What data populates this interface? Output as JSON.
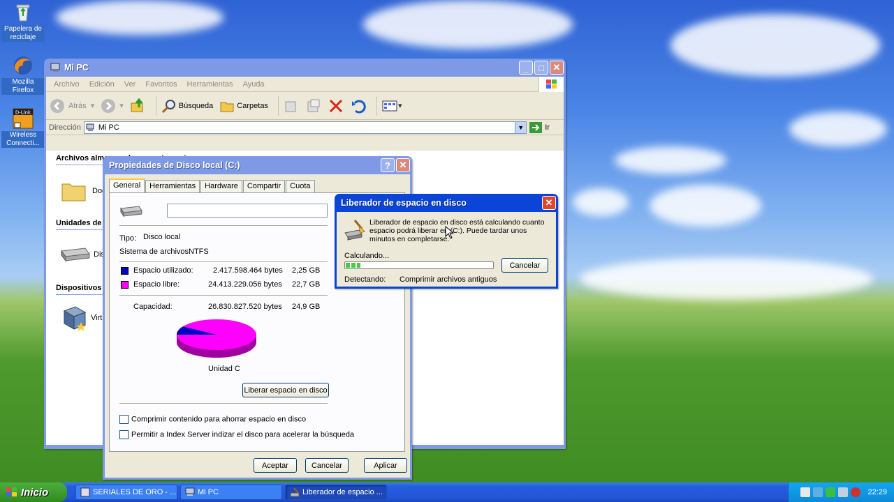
{
  "desktop": {
    "icons": [
      {
        "label": "Papelera de reciclaje"
      },
      {
        "label": "Mozilla Firefox"
      },
      {
        "label": "Wireless Connecti..."
      }
    ]
  },
  "mipc": {
    "title": "Mi PC",
    "menu": [
      "Archivo",
      "Edición",
      "Ver",
      "Favoritos",
      "Herramientas",
      "Ayuda"
    ],
    "toolbar": {
      "back": "Atrás",
      "search": "Búsqueda",
      "folders": "Carpetas"
    },
    "address": {
      "label": "Dirección",
      "value": "Mi PC",
      "go": "Ir"
    },
    "sections": {
      "stored": "Archivos almacenados en este equipo",
      "drives": "Unidades de",
      "devices": "Dispositivos"
    },
    "items": {
      "docs": "Doc",
      "disk": "Disc",
      "virt": "Virt"
    }
  },
  "props": {
    "title": "Propiedades de Disco local (C:)",
    "tabs": [
      "General",
      "Herramientas",
      "Hardware",
      "Compartir",
      "Cuota"
    ],
    "name_value": "",
    "type_label": "Tipo:",
    "type_value": "Disco local",
    "fs_label": "Sistema de archivos:",
    "fs_value": "NTFS",
    "used_label": "Espacio utilizado:",
    "used_bytes": "2.417.598.464 bytes",
    "used_gb": "2,25 GB",
    "free_label": "Espacio libre:",
    "free_bytes": "24.413.229.056 bytes",
    "free_gb": "22,7 GB",
    "cap_label": "Capacidad:",
    "cap_bytes": "26.830.827.520 bytes",
    "cap_gb": "24,9 GB",
    "used_color": "#0000c0",
    "free_color": "#ff00ff",
    "used_fraction": 0.09,
    "drive_label": "Unidad C",
    "cleanup_btn": "Liberar espacio en disco",
    "compress_label": "Comprimir contenido para ahorrar espacio en disco",
    "index_label": "Permitir a Index Server indizar el disco para acelerar la búsqueda",
    "ok": "Aceptar",
    "cancel": "Cancelar",
    "apply": "Aplicar"
  },
  "cleanup": {
    "title": "Liberador de espacio en disco",
    "message": "Liberador de espacio en disco está calculando cuanto espacio podrá liberar en (C:). Puede tardar unos minutos en completarse.",
    "calc_label": "Calculando...",
    "progress": 0.1,
    "cancel": "Cancelar",
    "detect_label": "Detectando:",
    "detect_value": "Comprimir archivos antiguos"
  },
  "taskbar": {
    "start": "Inicio",
    "tasks": [
      "SERIALES DE ORO - ...",
      "Mi PC",
      "Liberador de espacio ..."
    ],
    "clock": "22:29"
  }
}
